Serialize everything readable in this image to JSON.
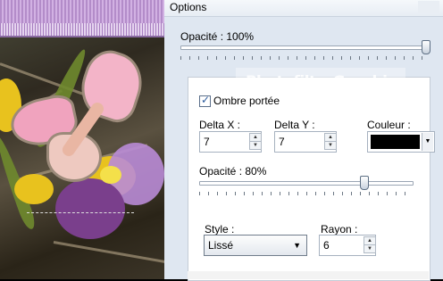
{
  "window": {
    "title": "Options"
  },
  "watermark": "PhotofiltreGraphic",
  "opacity_top": {
    "label": "Opacité : 100%",
    "value_percent": 100
  },
  "shadow": {
    "checkbox_label": "Ombre portée",
    "checked": true,
    "delta_x": {
      "label": "Delta X :",
      "value": "7"
    },
    "delta_y": {
      "label": "Delta Y :",
      "value": "7"
    },
    "color": {
      "label": "Couleur :",
      "value": "#000000"
    },
    "opacity": {
      "label": "Opacité : 80%",
      "value_percent": 80
    },
    "style": {
      "label": "Style :",
      "selected": "Lissé"
    },
    "radius": {
      "label": "Rayon :",
      "value": "6"
    }
  },
  "colors": {
    "dialog_bg": "#dfe7f1",
    "panel_bg": "#ffffff",
    "accent": "#2a5a9c"
  }
}
